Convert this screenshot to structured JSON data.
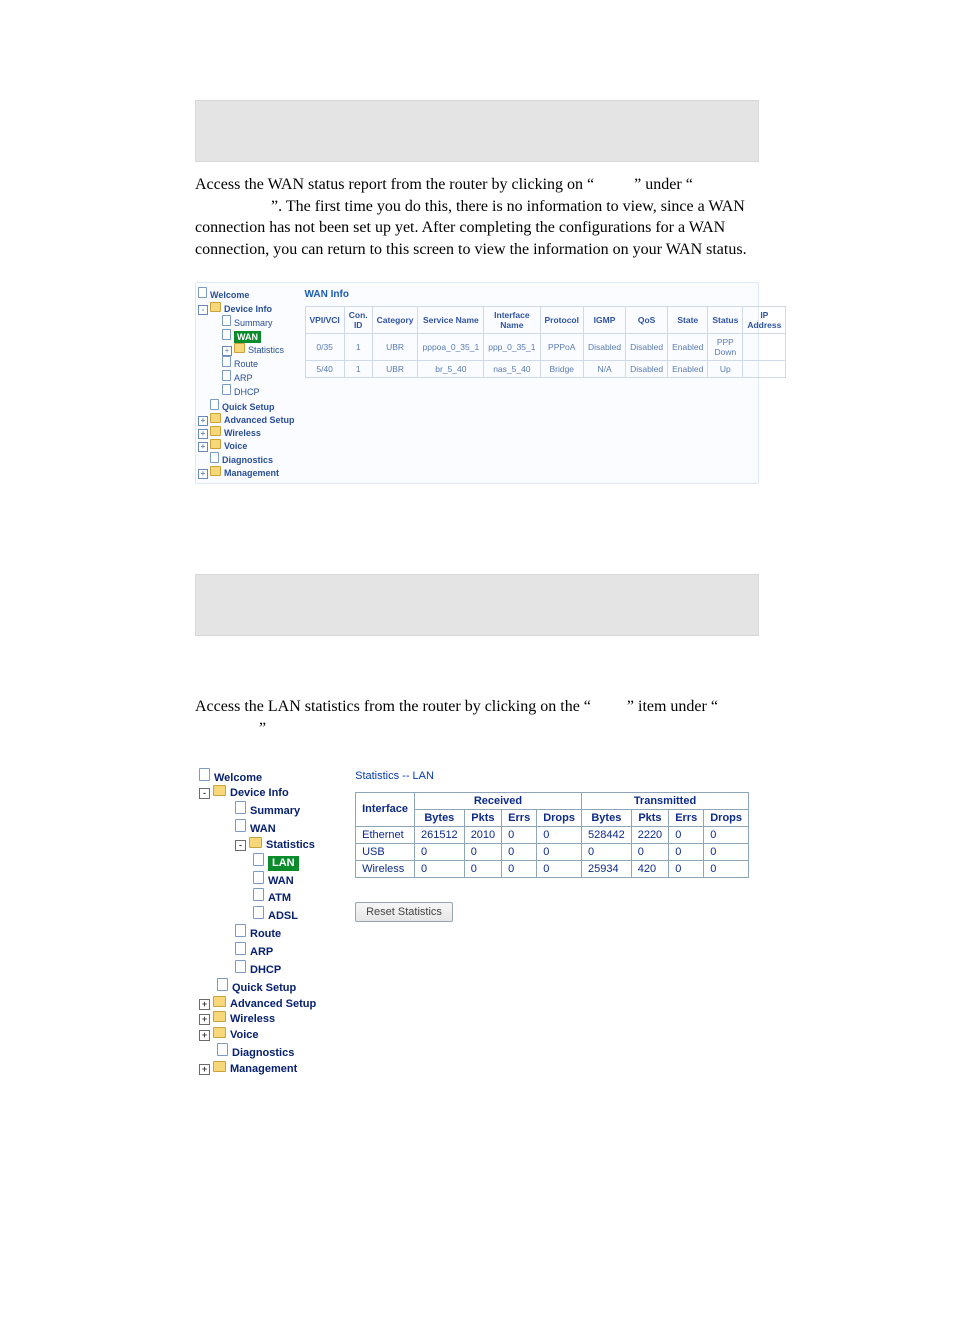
{
  "para1": {
    "a": "Access the WAN status report from the router by clicking on “",
    "b": "” under “",
    "c": "”. The first time you do this, there is no information to view, since a WAN connection has not been set up yet. After completing the configurations for a WAN connection, you can return to this screen to view the information on your WAN status."
  },
  "para2": {
    "a": "Access the LAN statistics from the router by clicking on the “",
    "b": "” item under “",
    "c": "”"
  },
  "nav1": {
    "welcome": "Welcome",
    "device_info": "Device Info",
    "summary": "Summary",
    "wan": "WAN",
    "statistics": "Statistics",
    "route": "Route",
    "arp": "ARP",
    "dhcp": "DHCP",
    "quick": "Quick Setup",
    "advanced": "Advanced Setup",
    "wireless": "Wireless",
    "voice": "Voice",
    "diagnostics": "Diagnostics",
    "management": "Management"
  },
  "wan": {
    "title": "WAN Info",
    "headers": {
      "vpivci": "VPI/VCI",
      "conid": "Con. ID",
      "category": "Category",
      "sname": "Service Name",
      "iname": "Interface Name",
      "proto": "Protocol",
      "igmp": "IGMP",
      "qos": "QoS",
      "state": "State",
      "status": "Status",
      "ip": "IP Address"
    },
    "rows": [
      {
        "vpivci": "0/35",
        "conid": "1",
        "category": "UBR",
        "sname": "pppoa_0_35_1",
        "iname": "ppp_0_35_1",
        "proto": "PPPoA",
        "igmp": "Disabled",
        "qos": "Disabled",
        "state": "Enabled",
        "status": "PPP Down",
        "ip": ""
      },
      {
        "vpivci": "5/40",
        "conid": "1",
        "category": "UBR",
        "sname": "br_5_40",
        "iname": "nas_5_40",
        "proto": "Bridge",
        "igmp": "N/A",
        "qos": "Disabled",
        "state": "Enabled",
        "status": "Up",
        "ip": ""
      }
    ]
  },
  "nav2": {
    "welcome": "Welcome",
    "device_info": "Device Info",
    "summary": "Summary",
    "wan": "WAN",
    "statistics": "Statistics",
    "lan": "LAN",
    "wan_s": "WAN",
    "atm": "ATM",
    "adsl": "ADSL",
    "route": "Route",
    "arp": "ARP",
    "dhcp": "DHCP",
    "quick": "Quick Setup",
    "advanced": "Advanced Setup",
    "wireless": "Wireless",
    "voice": "Voice",
    "diagnostics": "Diagnostics",
    "management": "Management"
  },
  "lanstats": {
    "title": "Statistics -- LAN",
    "headers": {
      "iface": "Interface",
      "recv": "Received",
      "trans": "Transmitted",
      "bytes": "Bytes",
      "pkts": "Pkts",
      "errs": "Errs",
      "drops": "Drops"
    },
    "rows": [
      {
        "iface": "Ethernet",
        "rb": "261512",
        "rp": "2010",
        "re": "0",
        "rd": "0",
        "tb": "528442",
        "tp": "2220",
        "te": "0",
        "td": "0"
      },
      {
        "iface": "USB",
        "rb": "0",
        "rp": "0",
        "re": "0",
        "rd": "0",
        "tb": "0",
        "tp": "0",
        "te": "0",
        "td": "0"
      },
      {
        "iface": "Wireless",
        "rb": "0",
        "rp": "0",
        "re": "0",
        "rd": "0",
        "tb": "25934",
        "tp": "420",
        "te": "0",
        "td": "0"
      }
    ],
    "reset": "Reset Statistics"
  }
}
